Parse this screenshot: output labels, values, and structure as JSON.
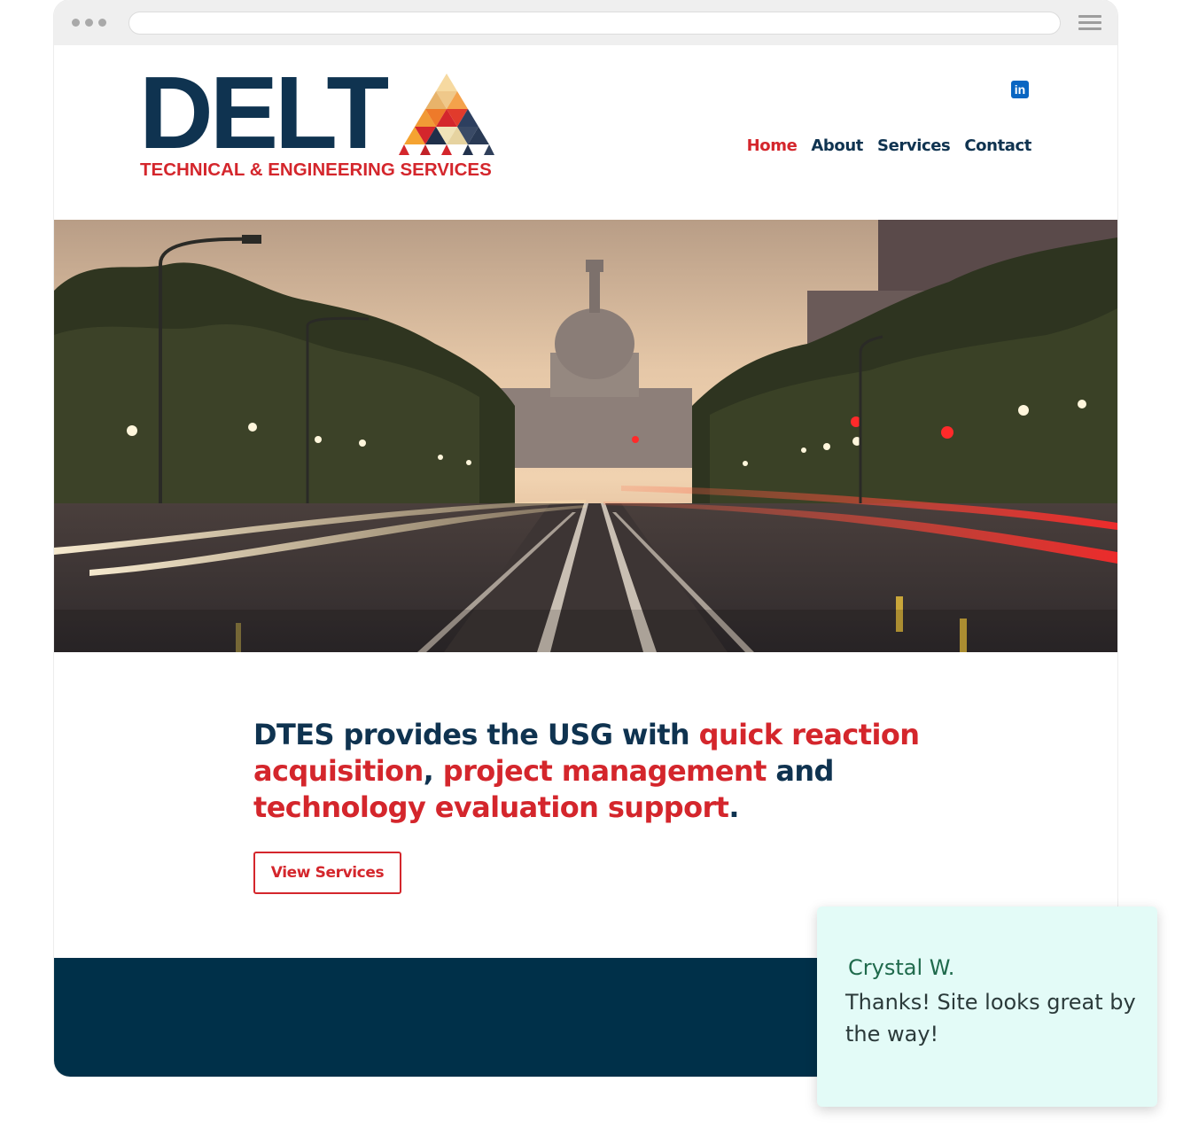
{
  "browser": {
    "url": ""
  },
  "logo": {
    "wordmark": "DELT",
    "tagline": "TECHNICAL & ENGINEERING SERVICES"
  },
  "social": {
    "linkedin_label": "in"
  },
  "nav": {
    "items": [
      {
        "label": "Home",
        "active": true
      },
      {
        "label": "About",
        "active": false
      },
      {
        "label": "Services",
        "active": false
      },
      {
        "label": "Contact",
        "active": false
      }
    ]
  },
  "hero": {
    "image_subject": "capitol-avenue-dusk-photo"
  },
  "headline": {
    "part1": "DTES provides the USG with ",
    "highlight1": "quick reaction acquisition",
    "part2": ", ",
    "highlight2": "project management",
    "part3": " and ",
    "highlight3": "technology evaluation support",
    "part4": "."
  },
  "cta": {
    "label": "View Services"
  },
  "testimonial": {
    "name": "Crystal W.",
    "text": "Thanks! Site looks great by the way!"
  },
  "colors": {
    "brand_navy": "#0f3350",
    "brand_red": "#d4262c",
    "footer_navy": "#003049",
    "testimonial_bg": "#e3fbf7"
  }
}
